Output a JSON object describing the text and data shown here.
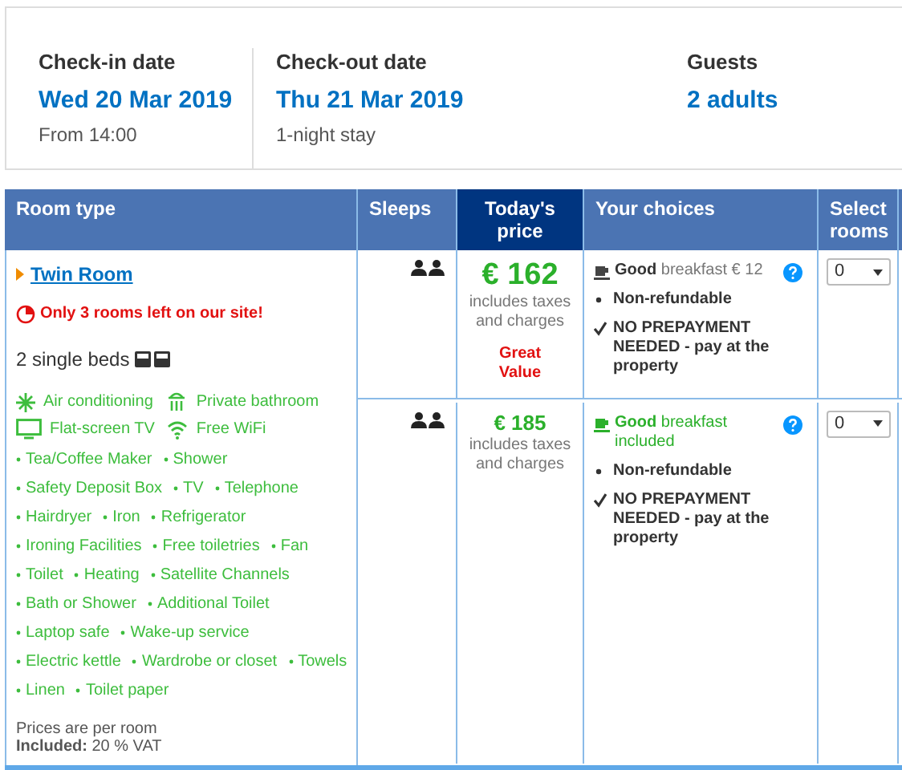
{
  "stay": [
    {
      "label": "Check-in date",
      "value": "Wed 20 Mar 2019",
      "note": "From 14:00"
    },
    {
      "label": "Check-out date",
      "value": "Thu 21 Mar 2019",
      "note": "1-night stay"
    },
    {
      "label": "Guests",
      "value": "2 adults"
    }
  ],
  "table": {
    "columns": [
      {
        "label": "Room type",
        "highlighted": false
      },
      {
        "label": "Sleeps",
        "highlighted": false
      },
      {
        "label": "Today's price",
        "highlighted": true
      },
      {
        "label": "Your choices",
        "highlighted": false
      },
      {
        "label": "Select rooms",
        "highlighted": false
      }
    ],
    "room": {
      "name": "Twin Room",
      "scarcity": "Only 3 rooms left on our site!",
      "beds": "2 single beds",
      "featured": [
        {
          "kind": "snowflake",
          "label": "Air conditioning"
        },
        {
          "kind": "shower",
          "label": "Private bathroom"
        },
        {
          "kind": "tv",
          "label": "Flat-screen TV"
        },
        {
          "kind": "wifi",
          "label": "Free WiFi"
        }
      ],
      "amenity_lines": [
        [
          "Tea/Coffee Maker",
          "Shower"
        ],
        [
          "Safety Deposit Box",
          "TV",
          "Telephone"
        ],
        [
          "Hairdryer",
          "Iron",
          "Refrigerator"
        ],
        [
          "Ironing Facilities",
          "Free toiletries",
          "Fan"
        ],
        [
          "Toilet",
          "Heating",
          "Satellite Channels"
        ],
        [
          "Bath or Shower",
          "Additional Toilet"
        ],
        [
          "Laptop safe",
          "Wake-up service"
        ],
        [
          "Electric kettle",
          "Wardrobe or closet",
          "Towels"
        ],
        [
          "Linen",
          "Toilet paper"
        ]
      ],
      "footnote": "Prices are per room",
      "vat": "**Included:** 20 % VAT"
    },
    "rows": [
      {
        "price": "€ 162",
        "emphasis": true,
        "price_note": "includes taxes and charges",
        "badge": "Great Value",
        "breakfast_quality": "Good",
        "breakfast": "breakfast € 12",
        "breakfast_included": false,
        "conditions": [
          {
            "kind": "bullet",
            "text": "Non-refundable"
          },
          {
            "kind": "check",
            "text": "NO PREPAYMENT NEEDED - pay at the property"
          }
        ],
        "select": "0"
      },
      {
        "price": "€ 185",
        "emphasis": false,
        "price_note": "includes taxes and charges",
        "breakfast_quality": "Good",
        "breakfast": "breakfast included",
        "breakfast_included": true,
        "conditions": [
          {
            "kind": "bullet",
            "text": "Non-refundable"
          },
          {
            "kind": "check",
            "text": "NO PREPAYMENT NEEDED - pay at the property"
          }
        ],
        "select": "0"
      }
    ]
  }
}
